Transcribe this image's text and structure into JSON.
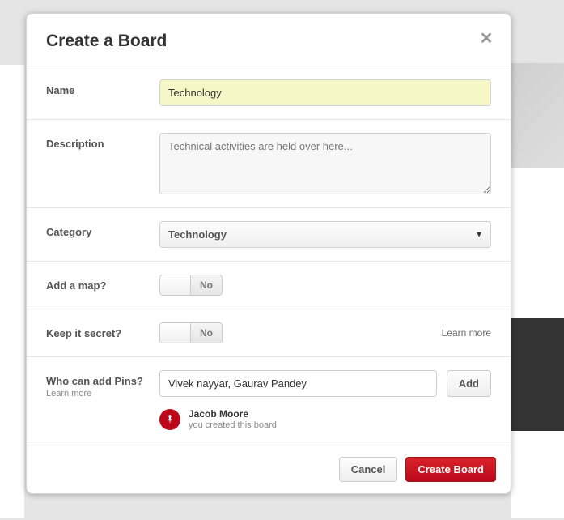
{
  "modal": {
    "title": "Create a Board",
    "close": "✕"
  },
  "name": {
    "label": "Name",
    "value": "Technology"
  },
  "description": {
    "label": "Description",
    "value": "Technical activities are held over here..."
  },
  "category": {
    "label": "Category",
    "selected": "Technology"
  },
  "map": {
    "label": "Add a map?",
    "toggle": "No"
  },
  "secret": {
    "label": "Keep it secret?",
    "toggle": "No",
    "learn_more": "Learn more"
  },
  "pins": {
    "label": "Who can add Pins?",
    "learn_more": "Learn more",
    "input_value": "Vivek nayyar, Gaurav Pandey",
    "add_label": "Add",
    "creator_name": "Jacob Moore",
    "creator_sub": "you created this board"
  },
  "footer": {
    "cancel": "Cancel",
    "create": "Create Board"
  }
}
